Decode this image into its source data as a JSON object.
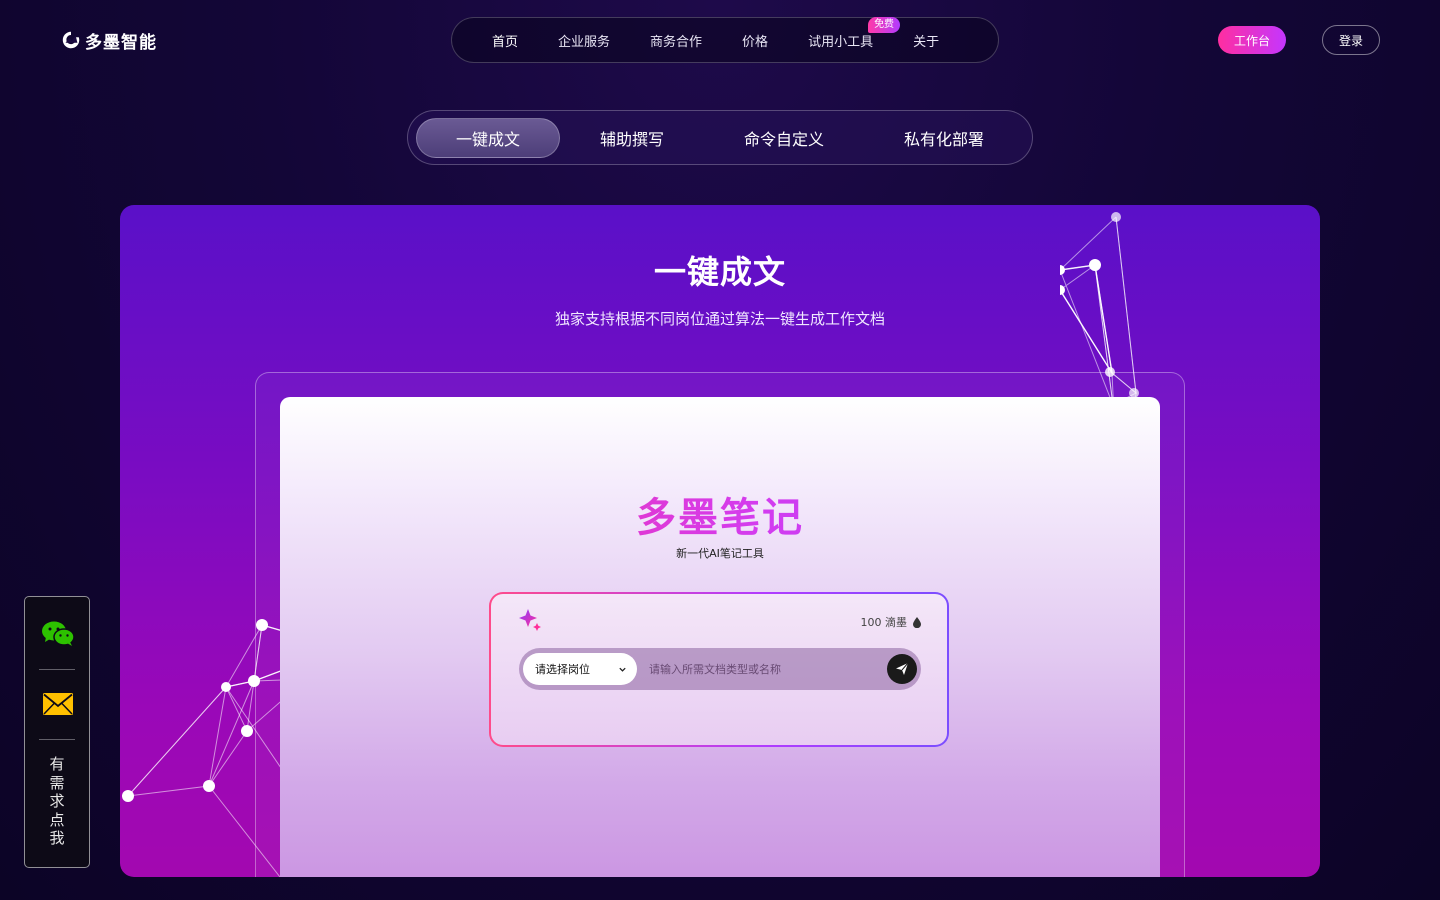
{
  "brand": {
    "name": "多墨智能"
  },
  "nav": {
    "items": [
      {
        "label": "首页"
      },
      {
        "label": "企业服务"
      },
      {
        "label": "商务合作"
      },
      {
        "label": "价格"
      },
      {
        "label": "试用小工具",
        "badge": "免费"
      },
      {
        "label": "关于"
      }
    ],
    "workbench": "工作台",
    "login": "登录"
  },
  "feature_tabs": [
    {
      "label": "一键成文",
      "active": true
    },
    {
      "label": "辅助撰写",
      "active": false
    },
    {
      "label": "命令自定义",
      "active": false
    },
    {
      "label": "私有化部署",
      "active": false
    }
  ],
  "hero": {
    "title": "一键成文",
    "subtitle": "独家支持根据不同岗位通过算法一键生成工作文档"
  },
  "app": {
    "name": "多墨笔记",
    "tagline": "新一代AI笔记工具",
    "balance": "100 滴墨",
    "role_select": "请选择岗位",
    "input_placeholder": "请输入所需文档类型或名称"
  },
  "contact": {
    "chars": [
      "有",
      "需",
      "求",
      "点",
      "我"
    ]
  },
  "colors": {
    "accent_pink": "#ff2ea0",
    "accent_purple": "#c436ff",
    "hero_top": "#5a10c8",
    "hero_bottom": "#a308b0",
    "wechat_green": "#2dc100",
    "mail_yellow": "#ffc000"
  }
}
